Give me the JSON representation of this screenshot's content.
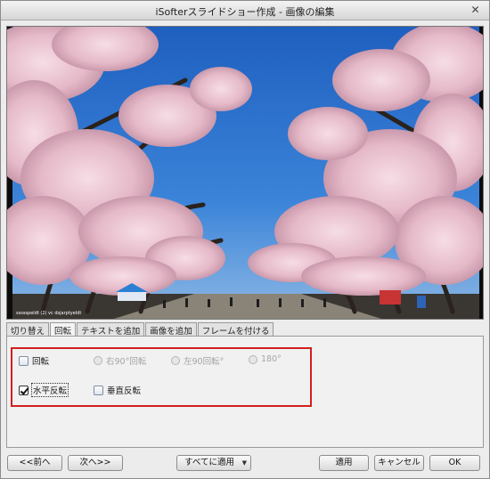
{
  "window": {
    "title": "iSofterスライドショー作成 - 画像の編集"
  },
  "preview": {
    "watermark": "ssssspeldt (2) vc dsjarptyeldt"
  },
  "tabs": [
    {
      "label": "切り替え"
    },
    {
      "label": "回転"
    },
    {
      "label": "テキストを追加"
    },
    {
      "label": "画像を追加"
    },
    {
      "label": "フレームを付ける"
    }
  ],
  "rotation": {
    "rotate_label": "回転",
    "rotate_checked": false,
    "right90_label": "右90°回転",
    "left90_label": "左90回転°",
    "r180_label": "180°",
    "hflip_label": "水平反転",
    "hflip_checked": true,
    "vflip_label": "垂直反転",
    "vflip_checked": false
  },
  "buttons": {
    "prev": "<<前へ",
    "next": "次へ>>",
    "apply_all": "すべてに適用",
    "apply": "適用",
    "cancel": "キャンセル",
    "ok": "OK"
  },
  "icons": {
    "close": "close-icon",
    "dropdown": "chevron-down-icon"
  },
  "colors": {
    "highlight_box": "#d21f1f",
    "sky": "#2f6fc7",
    "blossom": "#e9c2cf"
  }
}
